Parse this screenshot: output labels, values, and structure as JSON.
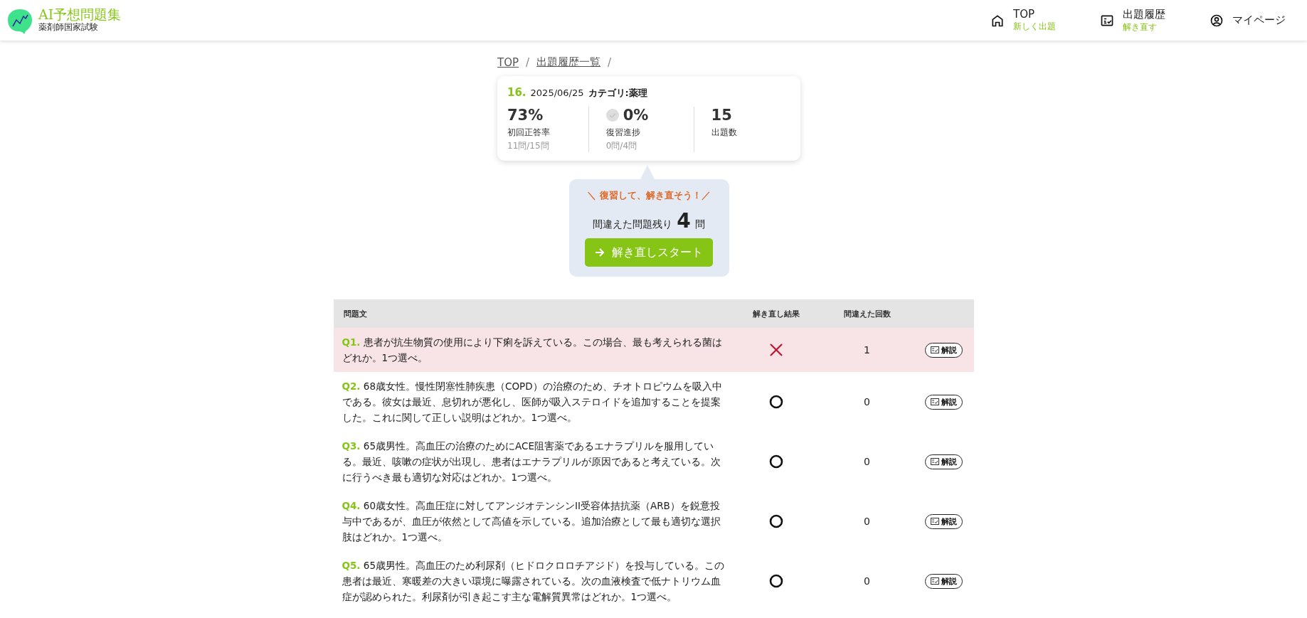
{
  "header": {
    "logo_title": "AI予想問題集",
    "logo_subtitle": "薬剤師国家試験",
    "nav": [
      {
        "kind": "home",
        "label": "TOP",
        "sublabel": "新しく出題"
      },
      {
        "kind": "history",
        "label": "出題履歴",
        "sublabel": "解き直す"
      },
      {
        "kind": "user",
        "label": "マイページ"
      }
    ]
  },
  "breadcrumb": {
    "separator": "/",
    "items": [
      "TOP",
      "出題履歴一覧"
    ]
  },
  "summary": {
    "number": "16.",
    "date": "2025/06/25",
    "category": "カテゴリ:薬理",
    "stats": [
      {
        "kind": "plain",
        "value": "73%",
        "label": "初回正答率",
        "detail": "11問/15問"
      },
      {
        "kind": "check",
        "value": "0%",
        "label": "復習進捗",
        "detail": "0問/4問"
      },
      {
        "kind": "plain",
        "value": "15",
        "label": "出題数"
      }
    ]
  },
  "retry": {
    "slogan": "＼ 復習して、解き直そう！／",
    "remaining_prefix": "間違えた問題残り",
    "remaining_count": "4",
    "remaining_suffix": "問",
    "button": "解き直しスタート"
  },
  "table": {
    "columns": [
      "問題文",
      "解き直し結果",
      "間違えた回数"
    ],
    "rows": [
      {
        "number": "Q1.",
        "text": "患者が抗生物質の使用により下痢を訴えている。この場合、最も考えられる菌はどれか。1つ選べ。",
        "kind": "wrong",
        "count": "1",
        "button": "解説"
      },
      {
        "number": "Q2.",
        "text": "68歳女性。慢性閉塞性肺疾患（COPD）の治療のため、チオトロピウムを吸入中である。彼女は最近、息切れが悪化し、医師が吸入ステロイドを追加することを提案した。これに関して正しい説明はどれか。1つ選べ。",
        "kind": "correct",
        "count": "0",
        "button": "解説"
      },
      {
        "number": "Q3.",
        "text": "65歳男性。高血圧の治療のためにACE阻害薬であるエナラプリルを服用している。最近、咳嗽の症状が出現し、患者はエナラプリルが原因であると考えている。次に行うべき最も適切な対応はどれか。1つ選べ。",
        "kind": "correct",
        "count": "0",
        "button": "解説"
      },
      {
        "number": "Q4.",
        "text": "60歳女性。高血圧症に対してアンジオテンシンII受容体拮抗薬（ARB）を鋭意投与中であるが、血圧が依然として高値を示している。追加治療として最も適切な選択肢はどれか。1つ選べ。",
        "kind": "correct",
        "count": "0",
        "button": "解説"
      },
      {
        "number": "Q5.",
        "text": "65歳男性。高血圧のため利尿剤（ヒドロクロロチアジド）を投与している。この患者は最近、寒暖差の大きい環境に曝露されている。次の血液検査で低ナトリウム血症が認められた。利尿剤が引き起こす主な電解質異常はどれか。1つ選べ。",
        "kind": "correct",
        "count": "0",
        "button": "解説"
      }
    ]
  }
}
